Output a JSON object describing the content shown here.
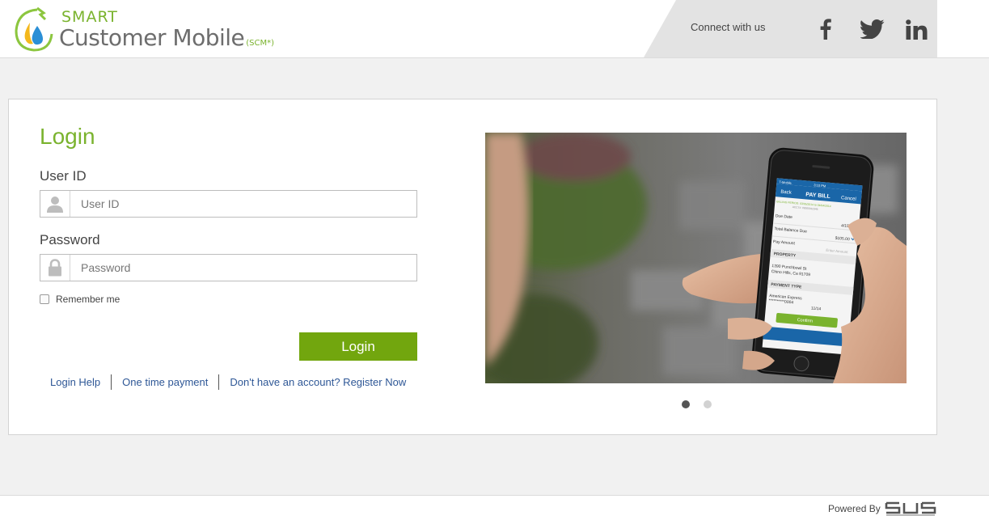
{
  "header": {
    "logo_smart": "SMART",
    "logo_main": "Customer Mobile",
    "logo_suffix": "(SCM*)",
    "connect_text": "Connect with us",
    "social": [
      "facebook-icon",
      "twitter-icon",
      "linkedin-icon"
    ]
  },
  "login": {
    "title": "Login",
    "user_label": "User ID",
    "user_placeholder": "User ID",
    "password_label": "Password",
    "password_placeholder": "Password",
    "remember_label": "Remember me",
    "button_label": "Login",
    "links": [
      "Login Help",
      "One time payment",
      "Don't have an account? Register Now"
    ]
  },
  "phone": {
    "carrier": "T-Mobile",
    "time": "3:10 PM",
    "back": "Back",
    "title": "PAY BILL",
    "cancel": "Cancel",
    "billing_period": "BILLING PERIOD: 03/05/2014 to 04/04/2014",
    "account": "ACCT#: 00000012345",
    "due_date_label": "Due Date",
    "due_date": "4/15/14",
    "balance_label": "Total Balance Due",
    "balance": "$105.00",
    "pay_amount_label": "Pay Amount",
    "pay_amount_placeholder": "Enter Amount",
    "property_header": "PROPERTY",
    "address_line1": "1390 Punchbowl St",
    "address_line2": "Chino Hills, Ca 91709",
    "payment_header": "PAYMENT TYPE",
    "card_name": "American Express",
    "card_number": "**********0004",
    "card_exp": "11/14",
    "confirm": "Confirm"
  },
  "carousel": {
    "slide_count": 2,
    "active_index": 0
  },
  "footer": {
    "powered_by": "Powered By",
    "brand": "SUS"
  },
  "colors": {
    "brand_green": "#7ab32e",
    "button_green": "#72a60e",
    "link_blue": "#2e5796",
    "app_blue": "#1a66a8"
  }
}
